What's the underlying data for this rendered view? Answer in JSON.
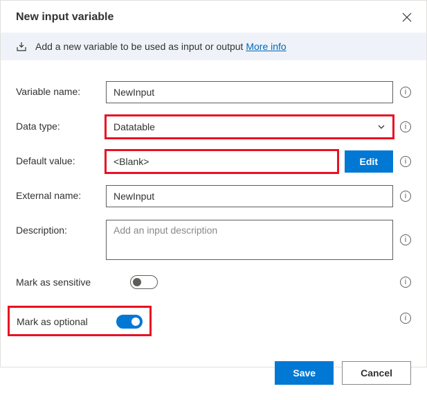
{
  "header": {
    "title": "New input variable"
  },
  "banner": {
    "text": "Add a new variable to be used as input or output ",
    "link_text": "More info"
  },
  "form": {
    "variable_name": {
      "label": "Variable name:",
      "value": "NewInput"
    },
    "data_type": {
      "label": "Data type:",
      "value": "Datatable"
    },
    "default_value": {
      "label": "Default value:",
      "value": "<Blank>",
      "edit_label": "Edit"
    },
    "external_name": {
      "label": "External name:",
      "value": "NewInput"
    },
    "description": {
      "label": "Description:",
      "placeholder": "Add an input description"
    },
    "mark_sensitive": {
      "label": "Mark as sensitive",
      "on": false
    },
    "mark_optional": {
      "label": "Mark as optional",
      "on": true
    }
  },
  "footer": {
    "save_label": "Save",
    "cancel_label": "Cancel"
  }
}
